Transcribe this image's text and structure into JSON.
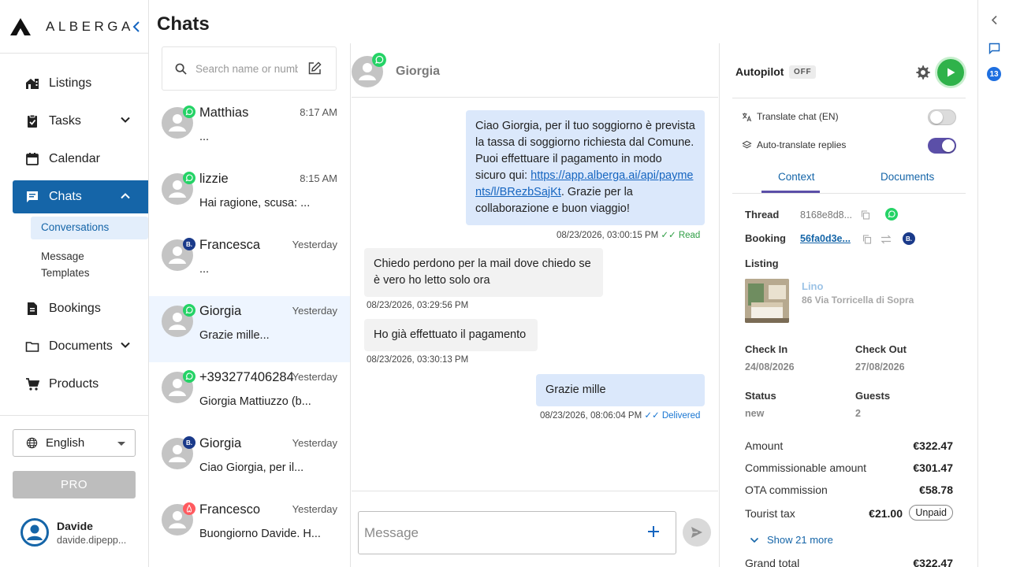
{
  "brand": {
    "name": "ALBERGA"
  },
  "page_title": "Chats",
  "nav": {
    "items": [
      {
        "label": "Listings"
      },
      {
        "label": "Tasks"
      },
      {
        "label": "Calendar"
      },
      {
        "label": "Chats"
      },
      {
        "label": "Bookings"
      },
      {
        "label": "Documents"
      },
      {
        "label": "Products"
      }
    ],
    "chat_sub": [
      {
        "label": "Conversations"
      },
      {
        "label": "Message Templates"
      }
    ]
  },
  "language": {
    "selected": "English"
  },
  "pro": {
    "label": "PRO"
  },
  "user": {
    "name": "Davide",
    "email": "davide.dipepp..."
  },
  "search": {
    "placeholder": "Search name or number"
  },
  "chats": [
    {
      "name": "Matthias",
      "time": "8:17 AM",
      "preview": "...",
      "channel": "whatsapp"
    },
    {
      "name": "lizzie",
      "time": "8:15 AM",
      "preview": "Hai ragione, scusa: ...",
      "channel": "whatsapp"
    },
    {
      "name": "Francesca",
      "time": "Yesterday",
      "preview": "...",
      "channel": "booking"
    },
    {
      "name": "Giorgia",
      "time": "Yesterday",
      "preview": "Grazie mille...",
      "channel": "whatsapp"
    },
    {
      "name": "+393277406284",
      "time": "Yesterday",
      "preview": "Giorgia Mattiuzzo (b...",
      "channel": "whatsapp"
    },
    {
      "name": "Giorgia",
      "time": "Yesterday",
      "preview": "Ciao Giorgia, per il...",
      "channel": "booking"
    },
    {
      "name": "Francesco",
      "time": "Yesterday",
      "preview": "Buongiorno Davide. H...",
      "channel": "airbnb"
    }
  ],
  "conversation": {
    "title": "Giorgia",
    "messages": [
      {
        "direction": "out",
        "text_before": "Ciao Giorgia, per il tuo soggiorno è prevista la tassa di soggiorno richiesta dal Comune. Puoi effettuare il pagamento in modo sicuro qui: ",
        "link": "https://app.alberga.ai/api/payments/l/BRezbSajKt",
        "text_after": ". Grazie per la collaborazione e buon viaggio!",
        "timestamp": "08/23/2026, 03:00:15 PM",
        "status": "✓✓ Read"
      },
      {
        "direction": "in",
        "text": "Chiedo perdono per la mail dove chiedo se è vero ho letto solo ora",
        "timestamp": "08/23/2026, 03:29:56 PM"
      },
      {
        "direction": "in",
        "text": "Ho già effettuato il pagamento",
        "timestamp": "08/23/2026, 03:30:13 PM"
      },
      {
        "direction": "out",
        "text": "Grazie mille",
        "timestamp": "08/23/2026, 08:06:04 PM",
        "status": "✓✓ Delivered"
      }
    ],
    "input_placeholder": "Message"
  },
  "panel": {
    "autopilot_label": "Autopilot",
    "autopilot_state": "OFF",
    "translate_chat": {
      "label": "Translate chat (EN)",
      "on": false
    },
    "auto_translate": {
      "label": "Auto-translate replies",
      "on": true
    },
    "tabs": [
      "Context",
      "Documents"
    ],
    "thread": {
      "label": "Thread",
      "value": "8168e8d8..."
    },
    "booking": {
      "label": "Booking",
      "value": "56fa0d3e..."
    },
    "listing": {
      "label": "Listing",
      "name": "Lino",
      "address": "86 Via Torricella di Sopra"
    },
    "check_in": {
      "label": "Check In",
      "value": "24/08/2026"
    },
    "check_out": {
      "label": "Check Out",
      "value": "27/08/2026"
    },
    "status": {
      "label": "Status",
      "value": "new"
    },
    "guests": {
      "label": "Guests",
      "value": "2"
    },
    "money": [
      {
        "label": "Amount",
        "value": "€322.47"
      },
      {
        "label": "Commissionable amount",
        "value": "€301.47"
      },
      {
        "label": "OTA commission",
        "value": "€58.78"
      }
    ],
    "tourist_tax": {
      "label": "Tourist tax",
      "value": "€21.00",
      "badge": "Unpaid"
    },
    "show_more": "Show 21 more",
    "grand_total": {
      "label": "Grand total",
      "value": "€322.47"
    }
  },
  "rail": {
    "badge_count": "13"
  },
  "colors": {
    "primary": "#1565a8",
    "whatsapp": "#25d366",
    "booking": "#1a3a8a",
    "airbnb": "#ff5a5f",
    "toggle_on": "#5b4fa8"
  }
}
